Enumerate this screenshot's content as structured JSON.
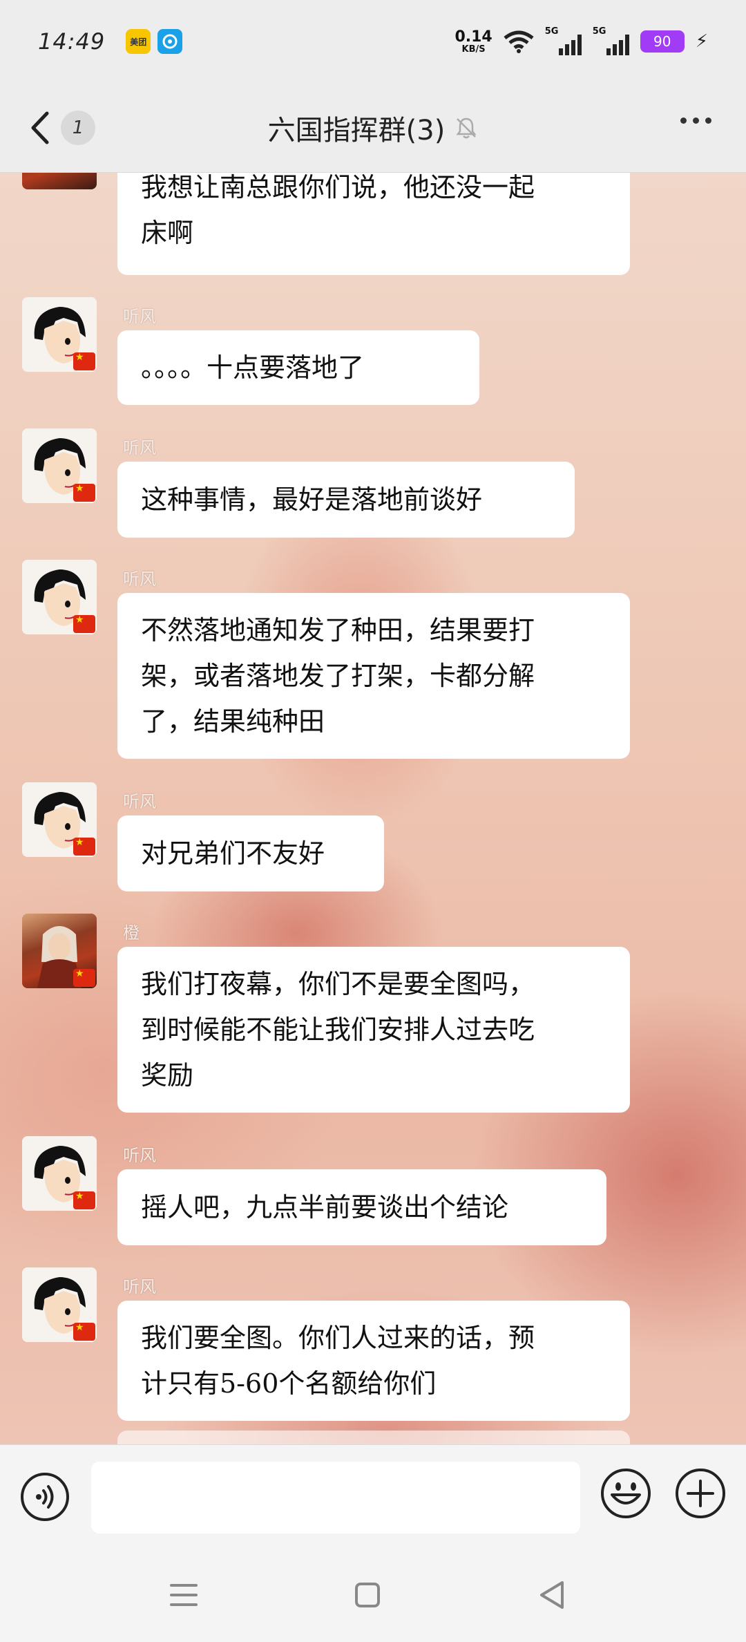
{
  "status_bar": {
    "time": "14:49",
    "apps": [
      "美团",
      "天气"
    ],
    "net_speed_value": "0.14",
    "net_speed_unit": "KB/S",
    "sim1_label": "5G",
    "sim2_label": "5G",
    "battery": "90"
  },
  "header": {
    "unread_count": "1",
    "title": "六国指挥群(3)"
  },
  "messages": [
    {
      "sender": "",
      "lines": [
        "我想让南总跟你们说，他还没一起",
        "床啊"
      ]
    },
    {
      "sender": "听风",
      "lines": [
        "。。。。十点要落地了"
      ]
    },
    {
      "sender": "听风",
      "lines": [
        "这种事情，最好是落地前谈好"
      ]
    },
    {
      "sender": "听风",
      "lines": [
        "不然落地通知发了种田，结果要打",
        "架，或者落地发了打架，卡都分解",
        "了，结果纯种田"
      ]
    },
    {
      "sender": "听风",
      "lines": [
        "对兄弟们不友好"
      ]
    },
    {
      "sender": "橙",
      "lines": [
        "我们打夜幕，你们不是要全图吗，",
        "到时候能不能让我们安排人过去吃",
        "奖励"
      ]
    },
    {
      "sender": "听风",
      "lines": [
        "摇人吧，九点半前要谈出个结论"
      ]
    },
    {
      "sender": "听风",
      "lines": [
        "我们要全图。你们人过来的话，预",
        "计只有5-60个名额给你们"
      ]
    }
  ],
  "input": {
    "value": "",
    "placeholder": ""
  },
  "colors": {
    "battery": "#a23bf5",
    "bubble": "#ffffff",
    "header_bg": "#ededed"
  }
}
